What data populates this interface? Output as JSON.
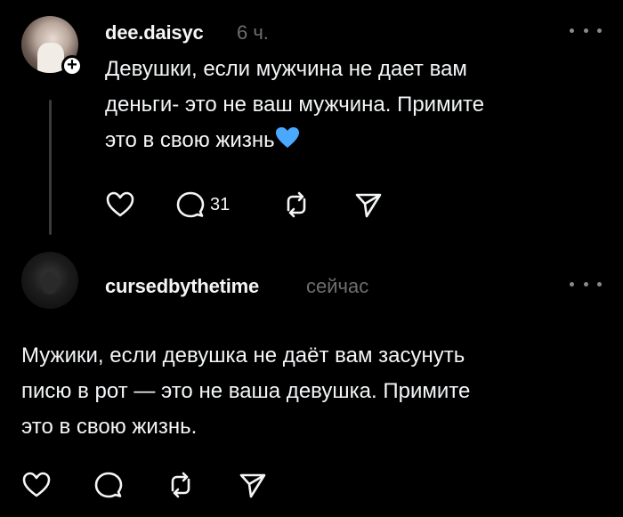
{
  "posts": [
    {
      "username": "dee.daisyc",
      "time": "6 ч.",
      "text": "Девушки, если мужчина не дает вам\nденьги- это не ваш мужчина. Примите\nэто в свою жизнь",
      "emoji": "blue-heart",
      "follow_badge": "+",
      "actions": {
        "like_icon": "heart-icon",
        "comment_icon": "comment-icon",
        "comment_count": "31",
        "repost_icon": "repost-icon",
        "share_icon": "send-icon"
      }
    },
    {
      "username": "cursedbythetime",
      "time": "сейчас",
      "text": "Мужики, если девушка не даёт вам засунуть\nписю в рот — это не ваша девушка. Примите\nэто в свою жизнь.",
      "actions": {
        "like_icon": "heart-icon",
        "comment_icon": "comment-icon",
        "repost_icon": "repost-icon",
        "share_icon": "send-icon"
      }
    }
  ],
  "colors": {
    "background": "#000000",
    "text": "#f3f5f7",
    "muted": "#6e6e6e",
    "emoji_blue": "#4aa8ff"
  }
}
